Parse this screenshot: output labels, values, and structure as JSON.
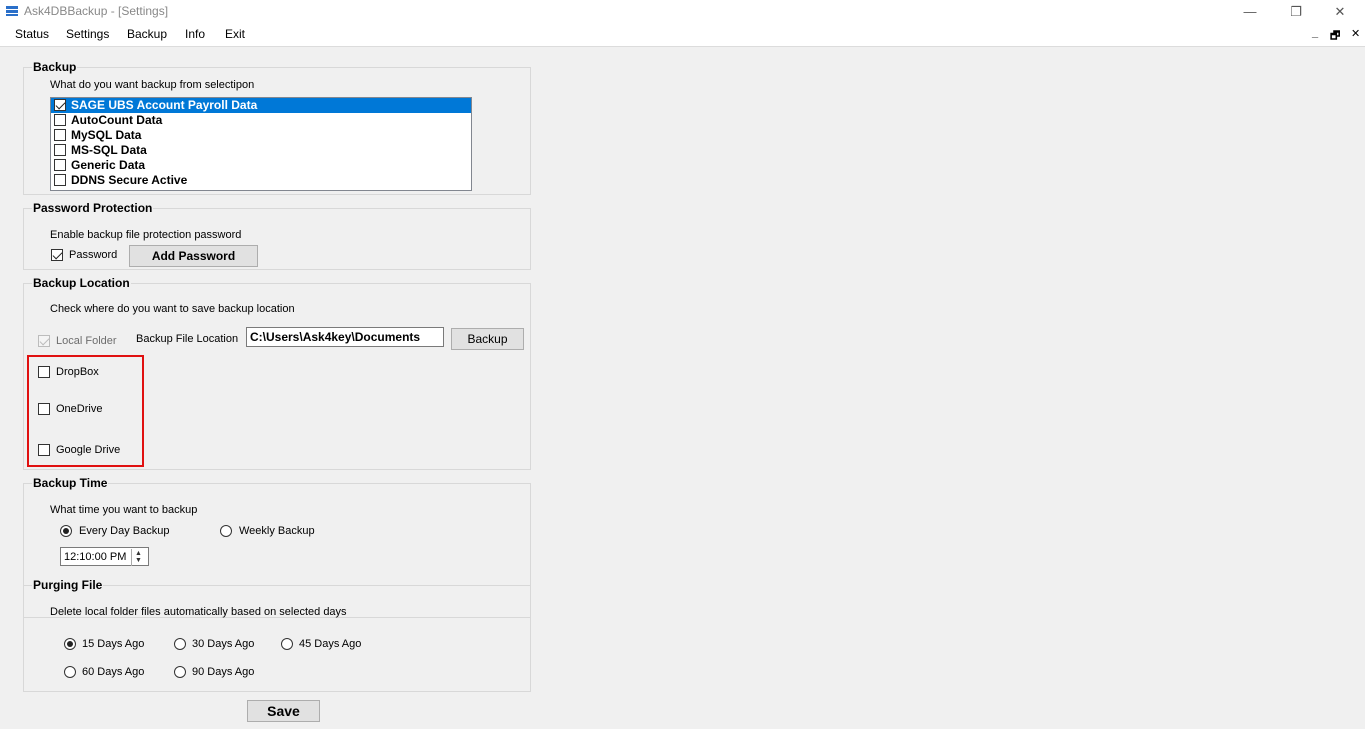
{
  "window": {
    "title": "Ask4DBBackup - [Settings]",
    "app_icon": "database-icon",
    "controls": {
      "minimize": "—",
      "restore": "❐",
      "close": "✕"
    }
  },
  "menu": {
    "items": [
      "Status",
      "Settings",
      "Backup",
      "Info",
      "Exit"
    ],
    "mdi_controls": {
      "minimize": "_",
      "restore": "🗗",
      "close": "✕"
    }
  },
  "backup": {
    "title": "Backup",
    "prompt": "What do you want backup from selectipon",
    "items": [
      {
        "label": "SAGE UBS Account Payroll Data",
        "checked": true,
        "selected": true
      },
      {
        "label": "AutoCount Data",
        "checked": false,
        "selected": false
      },
      {
        "label": "MySQL Data",
        "checked": false,
        "selected": false
      },
      {
        "label": "MS-SQL Data",
        "checked": false,
        "selected": false
      },
      {
        "label": "Generic Data",
        "checked": false,
        "selected": false
      },
      {
        "label": "DDNS Secure Active",
        "checked": false,
        "selected": false
      }
    ]
  },
  "password": {
    "title": "Password Protection",
    "prompt": "Enable backup file protection password",
    "checkbox_label": "Password",
    "checked": true,
    "button_label": "Add Password"
  },
  "location": {
    "title": "Backup Location",
    "prompt": "Check  where do you want to save backup location",
    "local_folder_label": "Local Folder",
    "file_location_label": "Backup File Location",
    "file_location_value": "C:\\Users\\Ask4key\\Documents",
    "browse_button_label": "Backup",
    "cloud_options": [
      {
        "label": "DropBox",
        "checked": false
      },
      {
        "label": "OneDrive",
        "checked": false
      },
      {
        "label": "Google Drive",
        "checked": false
      }
    ]
  },
  "time": {
    "title": "Backup Time",
    "prompt": "What time you want to backup",
    "options": [
      {
        "label": "Every Day Backup",
        "checked": true
      },
      {
        "label": "Weekly Backup",
        "checked": false
      }
    ],
    "time_value": "12:10:00 PM"
  },
  "purging": {
    "title": "Purging File",
    "prompt": "Delete local folder files automatically based on selected days",
    "options": [
      {
        "label": "15 Days Ago",
        "checked": true
      },
      {
        "label": "30 Days Ago",
        "checked": false
      },
      {
        "label": "45 Days Ago",
        "checked": false
      },
      {
        "label": "60 Days Ago",
        "checked": false
      },
      {
        "label": "90 Days Ago",
        "checked": false
      }
    ]
  },
  "save_label": "Save",
  "colors": {
    "selection": "#0078d7",
    "highlight_border": "#e01010"
  }
}
